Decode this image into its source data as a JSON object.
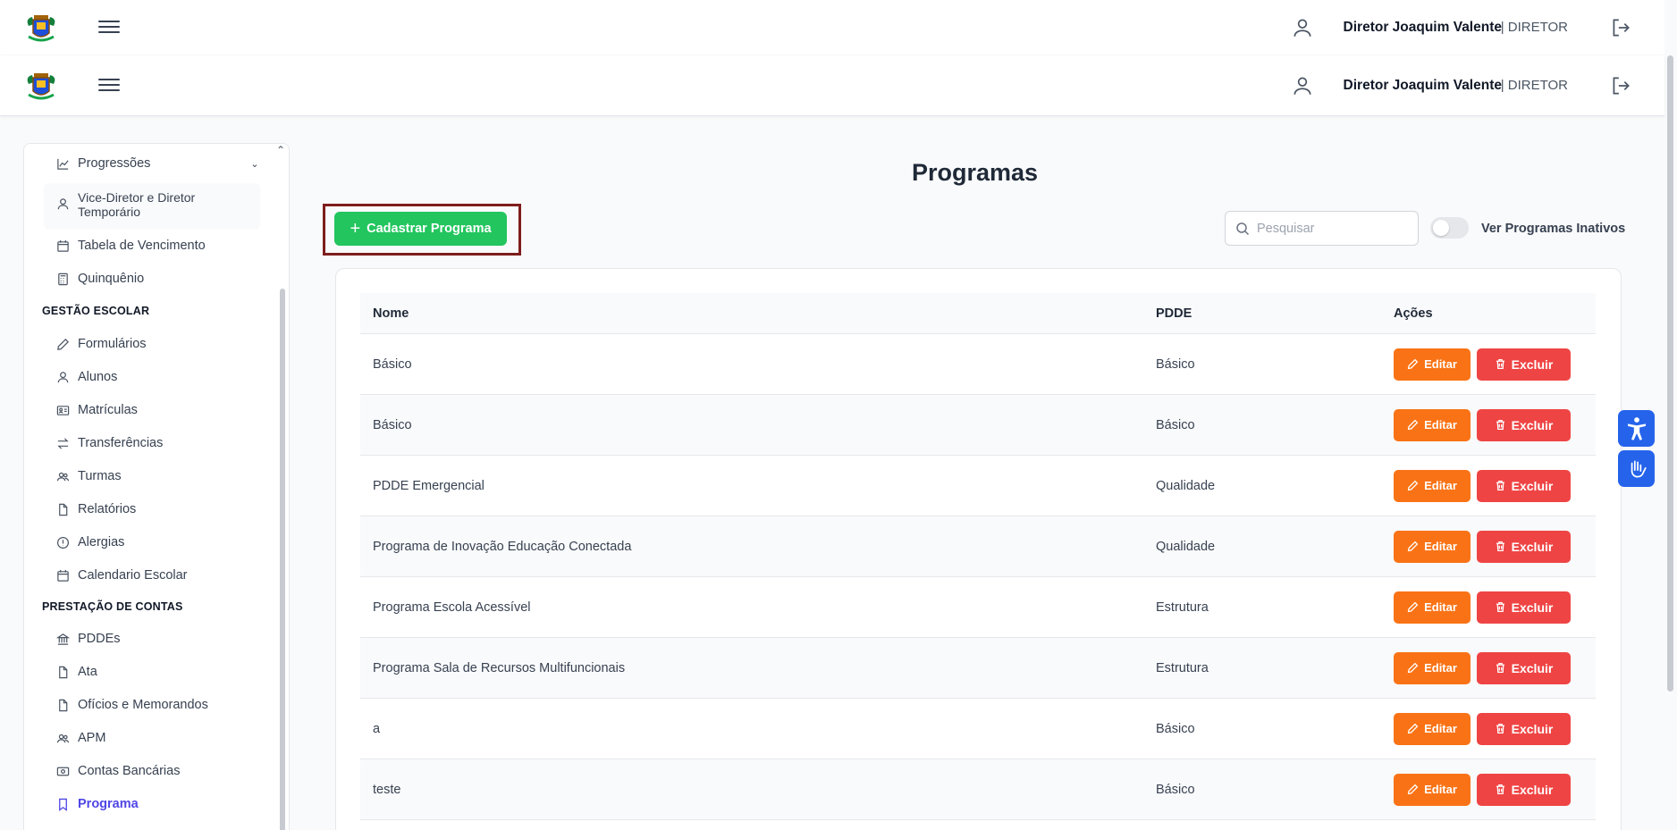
{
  "header": {
    "user_name": "Diretor Joaquim Valente",
    "user_role": "| DIRETOR"
  },
  "sidebar": {
    "items": [
      {
        "label": "Progressões"
      },
      {
        "label": "Vice-Diretor e Diretor Temporário"
      },
      {
        "label": "Tabela de Vencimento"
      },
      {
        "label": "Quinquênio"
      },
      {
        "label": "Formulários"
      },
      {
        "label": "Alunos"
      },
      {
        "label": "Matrículas"
      },
      {
        "label": "Transferências"
      },
      {
        "label": "Turmas"
      },
      {
        "label": "Relatórios"
      },
      {
        "label": "Alergias"
      },
      {
        "label": "Calendario Escolar"
      },
      {
        "label": "PDDEs"
      },
      {
        "label": "Ata"
      },
      {
        "label": "Ofícios e Memorandos"
      },
      {
        "label": "APM"
      },
      {
        "label": "Contas Bancárias"
      },
      {
        "label": "Programa"
      }
    ],
    "sections": [
      "GESTÃO ESCOLAR",
      "PRESTAÇÃO DE CONTAS"
    ],
    "vice_line1": "Vice-Diretor e Diretor",
    "vice_line2": "Temporário"
  },
  "main": {
    "title": "Programas",
    "add_button": "Cadastrar Programa",
    "search_placeholder": "Pesquisar",
    "toggle_label": "Ver Programas Inativos",
    "columns": [
      "Nome",
      "PDDE",
      "Ações"
    ],
    "edit_label": "Editar",
    "delete_label": "Excluir",
    "rows": [
      {
        "nome": "Básico",
        "pdde": "Básico"
      },
      {
        "nome": "Básico",
        "pdde": "Básico"
      },
      {
        "nome": "PDDE Emergencial",
        "pdde": "Qualidade"
      },
      {
        "nome": "Programa de Inovação Educação Conectada",
        "pdde": "Qualidade"
      },
      {
        "nome": "Programa Escola Acessível",
        "pdde": "Estrutura"
      },
      {
        "nome": "Programa Sala de Recursos Multifuncionais",
        "pdde": "Estrutura"
      },
      {
        "nome": "a",
        "pdde": "Básico"
      },
      {
        "nome": "teste",
        "pdde": "Básico"
      }
    ]
  },
  "colors": {
    "primary_green": "#22c55e",
    "edit_orange": "#f97316",
    "delete_red": "#ef4444",
    "active_link": "#4f46e5",
    "highlight_frame": "#7f1d1d",
    "accessibility_blue": "#2563eb"
  },
  "icons": [
    "logo-crest-icon",
    "menu-icon",
    "user-icon",
    "logout-icon",
    "search-icon",
    "plus-icon",
    "pencil-icon",
    "trash-icon",
    "accessibility-icon",
    "sign-language-icon"
  ]
}
